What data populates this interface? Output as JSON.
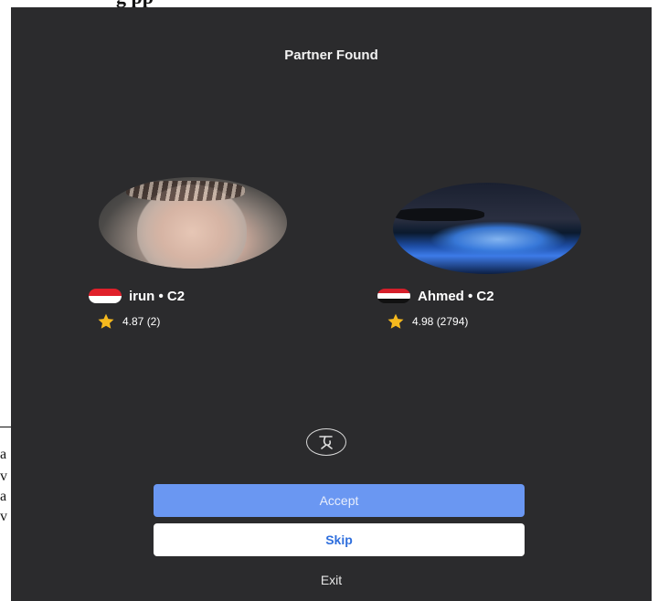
{
  "document": {
    "header_text": "g                                              pp",
    "side_fragments": [
      "a",
      "v",
      "a",
      "v"
    ]
  },
  "screen": {
    "title": "Partner Found",
    "users": [
      {
        "name": "irun • C2",
        "rating": "4.87 (2)",
        "flag_colors": [
          "#e0202a",
          "#ffffff"
        ],
        "avatar": "photo-woman-hijab"
      },
      {
        "name": "Ahmed • C2",
        "rating": "4.98 (2794)",
        "flag_colors": [
          "#d51f2a",
          "#ffffff",
          "#111111"
        ],
        "avatar": "photo-glowing-beach"
      }
    ],
    "logo_icon": "app-logo-icon",
    "accept_label": "Accept",
    "skip_label": "Skip",
    "exit_label": "Exit"
  },
  "colors": {
    "background": "#2b2b2d",
    "accept_button": "#6a97f2",
    "skip_button": "#ffffff",
    "skip_text": "#2f6fdd",
    "star": "#f5b91e"
  }
}
